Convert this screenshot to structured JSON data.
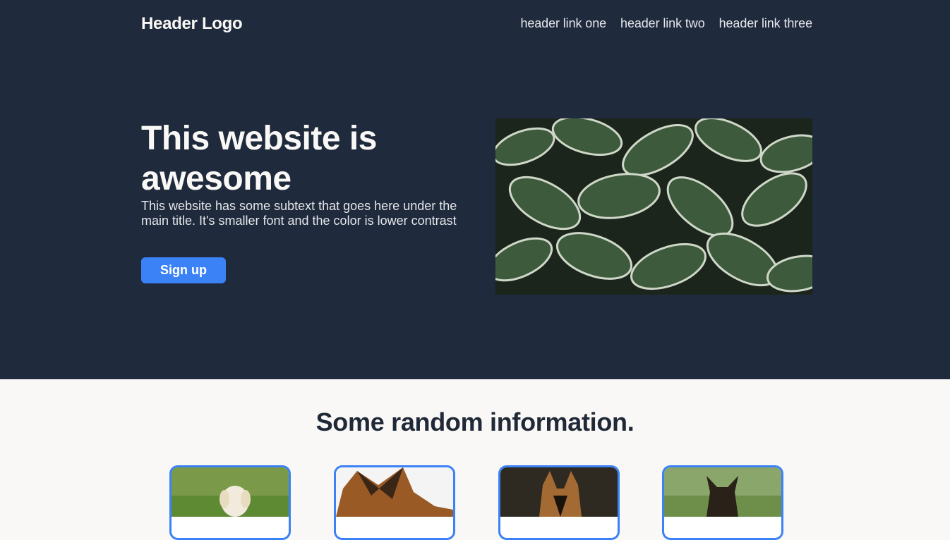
{
  "header": {
    "logo": "Header Logo",
    "links": [
      "header link one",
      "header link two",
      "header link three"
    ]
  },
  "hero": {
    "title": "This website is awesome",
    "subtitle": "This website has some subtext that goes here under the main title. It's smaller font and the color is lower contrast",
    "cta_label": "Sign up",
    "image": "hosta-leaves-photo"
  },
  "info": {
    "title": "Some random information.",
    "cards": [
      {
        "image": "golden-retriever-puppy-photo"
      },
      {
        "image": "german-shepherd-photo"
      },
      {
        "image": "german-shepherd-portrait-photo"
      },
      {
        "image": "german-shepherd-puppy-photo"
      }
    ]
  },
  "colors": {
    "hero_bg": "#1f2a3c",
    "accent": "#3b82f6",
    "page_bg": "#f9f8f6"
  }
}
